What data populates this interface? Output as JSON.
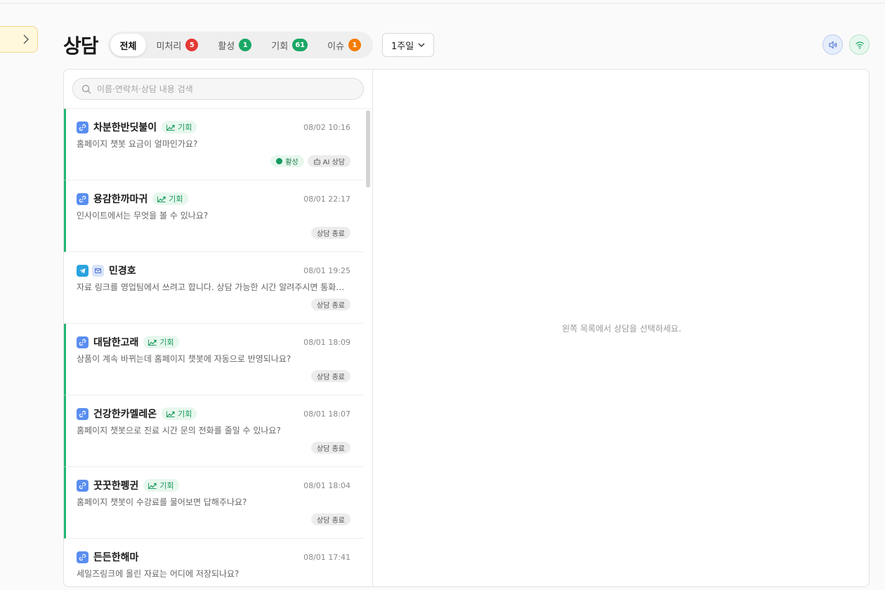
{
  "header": {
    "title": "상담",
    "tabs": [
      {
        "label": "전체",
        "count": ""
      },
      {
        "label": "미처리",
        "count": "5"
      },
      {
        "label": "활성",
        "count": "1"
      },
      {
        "label": "기회",
        "count": "61"
      },
      {
        "label": "이슈",
        "count": "1"
      }
    ],
    "period": "1주일"
  },
  "colors": {
    "accent_green": "#22b573",
    "badge_red": "#e53935",
    "badge_green": "#1aa865",
    "badge_orange": "#f57c00",
    "link_blue": "#5a8ef0"
  },
  "icons": {
    "sidebar_toggle": "chevron-right-icon",
    "speaker": "speaker-icon",
    "wifi": "wifi-icon",
    "search": "search-icon",
    "link": "link-icon",
    "telegram": "telegram-icon",
    "mail": "mail-icon",
    "trend": "trend-up-icon",
    "bot": "bot-icon"
  },
  "search": {
    "placeholder": "이름·연락처·상담 내용 검색"
  },
  "conversations": [
    {
      "name": "차분한반딧불이",
      "badge": "기회",
      "time": "08/02 10:16",
      "preview": "홈페이지 챗봇 요금이 얼마인가요?",
      "tags": [
        "활성",
        "AI 상담"
      ]
    },
    {
      "name": "용감한까마귀",
      "badge": "기회",
      "time": "08/01 22:17",
      "preview": "인사이트에서는 무엇을 볼 수 있나요?",
      "tags": [
        "상담 종료"
      ]
    },
    {
      "name": "민경호",
      "badge": "",
      "time": "08/01 19:25",
      "preview": "자료 링크를 영업팀에서 쓰려고 합니다. 상담 가능한 시간 알려주시면 통화하...",
      "tags": [
        "상담 종료"
      ]
    },
    {
      "name": "대담한고래",
      "badge": "기회",
      "time": "08/01 18:09",
      "preview": "상품이 계속 바뀌는데 홈페이지 챗봇에 자동으로 반영되나요?",
      "tags": [
        "상담 종료"
      ]
    },
    {
      "name": "건강한카멜레온",
      "badge": "기회",
      "time": "08/01 18:07",
      "preview": "홈페이지 챗봇으로 진료 시간 문의 전화를 줄일 수 있나요?",
      "tags": [
        "상담 종료"
      ]
    },
    {
      "name": "꿋꿋한펭귄",
      "badge": "기회",
      "time": "08/01 18:04",
      "preview": "홈페이지 챗봇이 수강료를 물어보면 답해주나요?",
      "tags": [
        "상담 종료"
      ]
    },
    {
      "name": "든든한해마",
      "badge": "",
      "time": "08/01 17:41",
      "preview": "세일즈링크에 올린 자료는 어디에 저장되나요?",
      "tags": []
    }
  ],
  "detail": {
    "empty_message": "왼쪽 목록에서 상담을 선택하세요."
  }
}
